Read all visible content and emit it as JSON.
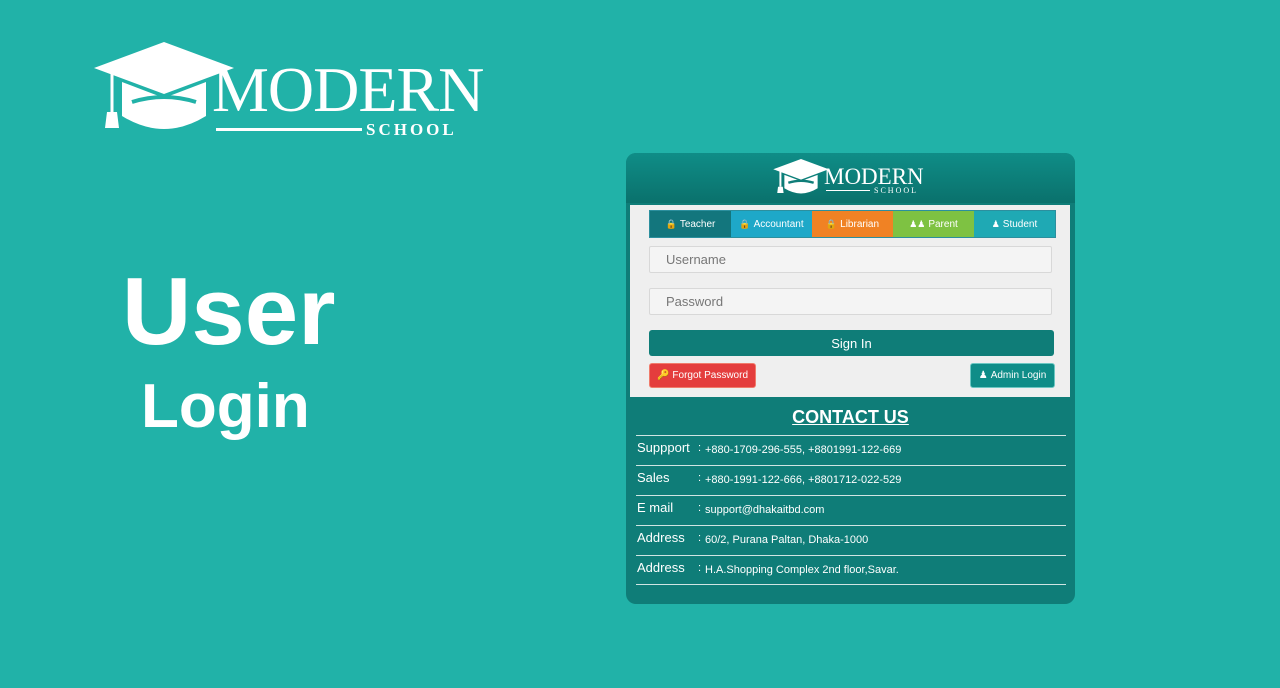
{
  "brand": {
    "name": "MODERN",
    "sub": "SCHOOL"
  },
  "title": {
    "line1": "User",
    "line2": "Login"
  },
  "card": {
    "tabs": [
      {
        "label": "Teacher"
      },
      {
        "label": "Accountant"
      },
      {
        "label": "Librarian"
      },
      {
        "label": "Parent"
      },
      {
        "label": "Student"
      }
    ],
    "username_placeholder": "Username",
    "password_placeholder": "Password",
    "signin_label": "Sign In",
    "forgot_label": "Forgot Password",
    "admin_label": "Admin Login"
  },
  "contact": {
    "title": "CONTACT US",
    "rows": [
      {
        "label": "Suppport",
        "sep": ":",
        "value": "+880-1709-296-555, +8801991-122-669"
      },
      {
        "label": "Sales",
        "sep": ":",
        "value": "+880-1991-122-666, +8801712-022-529"
      },
      {
        "label": "E mail",
        "sep": ":",
        "value": "support@dhakaitbd.com"
      },
      {
        "label": "Address",
        "sep": ":",
        "value": "60/2, Purana Paltan, Dhaka-1000"
      },
      {
        "label": "Address",
        "sep": ":",
        "value": "H.A.Shopping Complex 2nd floor,Savar."
      }
    ]
  },
  "colors": {
    "background": "#21b2a8",
    "card": "#0f7d78",
    "tab_teacher": "#13767d",
    "tab_accountant": "#1ea8c8",
    "tab_librarian": "#f08224",
    "tab_parent": "#7ec242",
    "tab_student": "#1fa9b4",
    "forgot": "#e43d3d"
  },
  "icons": {
    "logo": "graduation-cap-icon",
    "tab_user": "user-lock-icon",
    "parent": "users-icon",
    "student": "user-icon",
    "forgot": "key-icon",
    "admin": "user-icon"
  }
}
